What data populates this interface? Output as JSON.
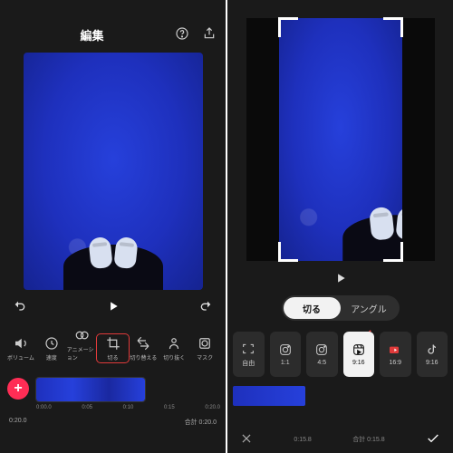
{
  "left": {
    "title": "編集",
    "tools": {
      "volume": "ボリューム",
      "speed": "速度",
      "animation": "アニメーション",
      "crop": "切る",
      "replace": "切り替える",
      "cutout": "切り抜く",
      "mask": "マスク"
    },
    "ticks": [
      "0:00.0",
      "0:05",
      "0:10",
      "0:15",
      "0:20.0"
    ],
    "position": "0:20.0",
    "total": "合計 0:20.0"
  },
  "right": {
    "seg_crop": "切る",
    "seg_angle": "アングル",
    "aspects": {
      "free": "自由",
      "1_1": "1:1",
      "4_5": "4:5",
      "9_16": "9:16",
      "16_9": "16:9",
      "9_16b": "9:16"
    },
    "position": "0:15.8",
    "total": "合計 0:15.8"
  }
}
